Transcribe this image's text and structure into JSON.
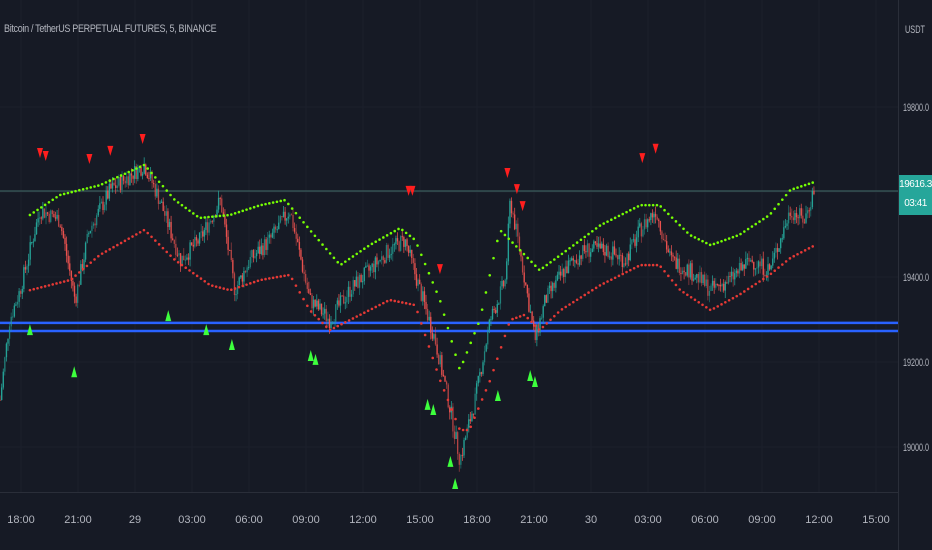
{
  "header": {
    "title": "Bitcoin / TetherUS PERPETUAL FUTURES, 5, BINANCE"
  },
  "price_axis": {
    "currency": "USDT",
    "last_price": "19616.3",
    "countdown": "03:41"
  },
  "colors": {
    "background": "#161a25",
    "up": "#26a69a",
    "down": "#ef5350",
    "upper_band": "#76ff03",
    "lower_band": "#e53935",
    "level_line": "#2962ff",
    "last_price": "#26a69a",
    "sell_marker": "#ff1e1e",
    "buy_marker": "#3dff3d"
  },
  "chart_data": {
    "type": "candlestick",
    "title": "Bitcoin / TetherUS PERPETUAL FUTURES, 5, BINANCE",
    "x_unit": "hours since first 18:00",
    "xlim": [
      -1.1,
      46.2
    ],
    "ylim": [
      18850,
      20050
    ],
    "y_ticks": [
      19800.0,
      19400.0,
      19200.0,
      19000.0
    ],
    "y_tick_labels": [
      "19800.0",
      "19400.0",
      "19200.0",
      "19000.0"
    ],
    "x_ticks": [
      0,
      3,
      6,
      9,
      12,
      15,
      18,
      21,
      24,
      27,
      30,
      33,
      36,
      39,
      42,
      45
    ],
    "x_tick_labels": [
      "18:00",
      "21:00",
      "29",
      "03:00",
      "06:00",
      "09:00",
      "12:00",
      "15:00",
      "18:00",
      "21:00",
      "30",
      "03:00",
      "06:00",
      "09:00",
      "12:00",
      "15:00"
    ],
    "price_path": [
      [
        -1.1,
        19111
      ],
      [
        -0.6,
        19299
      ],
      [
        -0.05,
        19369
      ],
      [
        1.0,
        19558
      ],
      [
        2.05,
        19534
      ],
      [
        2.85,
        19346
      ],
      [
        3.6,
        19511
      ],
      [
        4.7,
        19605
      ],
      [
        6.5,
        19664
      ],
      [
        7.3,
        19581
      ],
      [
        8.4,
        19440
      ],
      [
        9.4,
        19487
      ],
      [
        10.5,
        19581
      ],
      [
        11.25,
        19369
      ],
      [
        12.05,
        19440
      ],
      [
        13.1,
        19487
      ],
      [
        14.15,
        19558
      ],
      [
        15.2,
        19346
      ],
      [
        16.25,
        19299
      ],
      [
        17.3,
        19369
      ],
      [
        18.35,
        19416
      ],
      [
        19.4,
        19464
      ],
      [
        20.2,
        19487
      ],
      [
        21.0,
        19369
      ],
      [
        21.8,
        19252
      ],
      [
        22.6,
        19087
      ],
      [
        23.1,
        18969
      ],
      [
        23.9,
        19111
      ],
      [
        24.7,
        19299
      ],
      [
        25.5,
        19393
      ],
      [
        25.75,
        19581
      ],
      [
        26.25,
        19464
      ],
      [
        27.05,
        19252
      ],
      [
        27.6,
        19346
      ],
      [
        28.6,
        19416
      ],
      [
        29.7,
        19464
      ],
      [
        30.75,
        19464
      ],
      [
        31.8,
        19440
      ],
      [
        32.6,
        19511
      ],
      [
        33.4,
        19558
      ],
      [
        34.2,
        19440
      ],
      [
        35.2,
        19416
      ],
      [
        36.3,
        19369
      ],
      [
        37.3,
        19393
      ],
      [
        38.4,
        19440
      ],
      [
        39.4,
        19416
      ],
      [
        40.5,
        19558
      ],
      [
        41.25,
        19534
      ],
      [
        41.8,
        19616
      ]
    ],
    "upper_band": [
      [
        0.47,
        19546
      ],
      [
        2.05,
        19593
      ],
      [
        4.15,
        19616
      ],
      [
        6.5,
        19664
      ],
      [
        8.1,
        19581
      ],
      [
        9.4,
        19539
      ],
      [
        11.0,
        19546
      ],
      [
        12.6,
        19569
      ],
      [
        13.9,
        19581
      ],
      [
        15.2,
        19511
      ],
      [
        16.8,
        19428
      ],
      [
        18.35,
        19475
      ],
      [
        19.95,
        19515
      ],
      [
        20.75,
        19487
      ],
      [
        22.05,
        19346
      ],
      [
        23.1,
        19181
      ],
      [
        24.15,
        19299
      ],
      [
        25.2,
        19511
      ],
      [
        26.25,
        19464
      ],
      [
        27.3,
        19416
      ],
      [
        28.4,
        19452
      ],
      [
        30.5,
        19522
      ],
      [
        32.6,
        19569
      ],
      [
        33.6,
        19569
      ],
      [
        35.2,
        19499
      ],
      [
        36.3,
        19475
      ],
      [
        37.8,
        19499
      ],
      [
        39.4,
        19546
      ],
      [
        40.5,
        19605
      ],
      [
        41.8,
        19624
      ]
    ],
    "lower_band": [
      [
        0.47,
        19369
      ],
      [
        2.6,
        19393
      ],
      [
        4.15,
        19452
      ],
      [
        6.5,
        19511
      ],
      [
        8.1,
        19440
      ],
      [
        9.95,
        19381
      ],
      [
        11.0,
        19369
      ],
      [
        12.6,
        19393
      ],
      [
        14.15,
        19405
      ],
      [
        15.2,
        19322
      ],
      [
        16.25,
        19275
      ],
      [
        17.85,
        19311
      ],
      [
        19.4,
        19346
      ],
      [
        20.75,
        19334
      ],
      [
        22.05,
        19158
      ],
      [
        23.1,
        19040
      ],
      [
        23.6,
        19040
      ],
      [
        24.7,
        19158
      ],
      [
        25.75,
        19299
      ],
      [
        26.5,
        19311
      ],
      [
        27.3,
        19275
      ],
      [
        28.4,
        19322
      ],
      [
        30.5,
        19381
      ],
      [
        32.6,
        19428
      ],
      [
        33.6,
        19428
      ],
      [
        34.7,
        19369
      ],
      [
        36.3,
        19322
      ],
      [
        37.8,
        19358
      ],
      [
        39.4,
        19405
      ],
      [
        40.5,
        19445
      ],
      [
        41.8,
        19475
      ]
    ],
    "sell_signals": [
      [
        1.0,
        19694
      ],
      [
        1.3,
        19687
      ],
      [
        3.6,
        19680
      ],
      [
        4.7,
        19699
      ],
      [
        6.4,
        19727
      ],
      [
        20.4,
        19605
      ],
      [
        20.6,
        19605
      ],
      [
        22.05,
        19421
      ],
      [
        25.6,
        19647
      ],
      [
        26.1,
        19609
      ],
      [
        26.4,
        19569
      ],
      [
        32.7,
        19682
      ],
      [
        33.4,
        19704
      ]
    ],
    "buy_signals": [
      [
        0.47,
        19275
      ],
      [
        2.8,
        19176
      ],
      [
        7.75,
        19308
      ],
      [
        9.75,
        19275
      ],
      [
        11.1,
        19240
      ],
      [
        15.25,
        19214
      ],
      [
        15.5,
        19205
      ],
      [
        21.4,
        19099
      ],
      [
        21.7,
        19087
      ],
      [
        22.6,
        18965
      ],
      [
        22.85,
        18913
      ],
      [
        25.1,
        19120
      ],
      [
        26.8,
        19167
      ],
      [
        27.05,
        19153
      ]
    ],
    "horizontal_levels": [
      19292,
      19273
    ],
    "last_price_level": 19616.3
  }
}
